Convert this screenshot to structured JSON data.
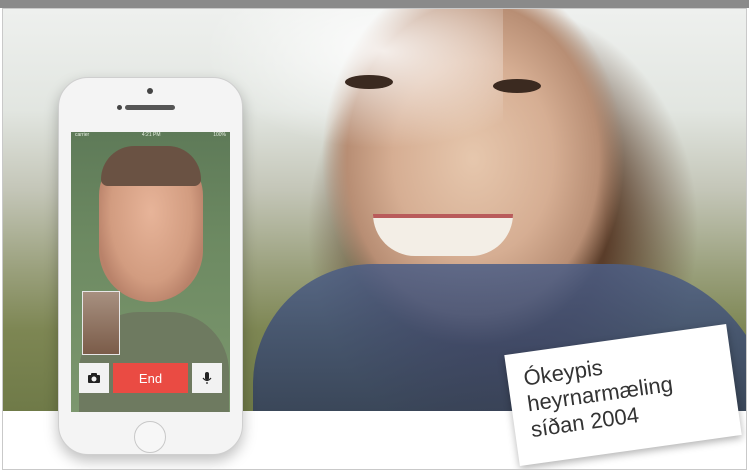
{
  "phone": {
    "status_left": "carrier",
    "status_center": "4:21 PM",
    "status_right": "100%",
    "end_label": "End",
    "camera_icon": "camera-icon",
    "mic_icon": "mic-icon",
    "end_color": "#ea4b43"
  },
  "note": {
    "line1": "Ókeypis",
    "line2": "heyrnarmæling",
    "line3": "síðan 2004"
  }
}
